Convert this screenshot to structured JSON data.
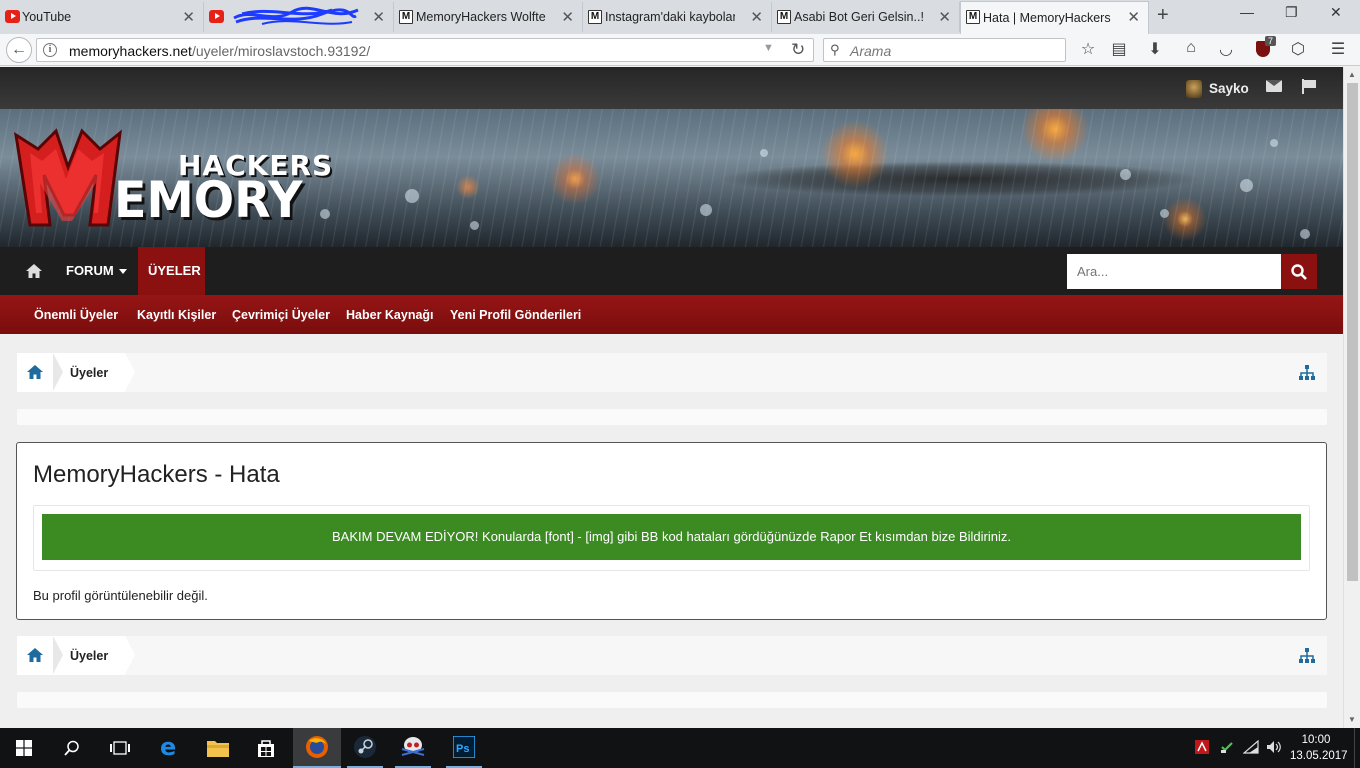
{
  "browser": {
    "tabs": [
      {
        "title": "YouTube",
        "favicon": "youtube-icon"
      },
      {
        "title": "",
        "favicon": "youtube-icon"
      },
      {
        "title": "MemoryHackers Wolfte",
        "favicon": "m-icon"
      },
      {
        "title": "Instagram'daki kaybolan",
        "favicon": "m-icon"
      },
      {
        "title": "Asabi Bot Geri Gelsin..!(S",
        "favicon": "m-icon"
      },
      {
        "title": "Hata | MemoryHackers",
        "favicon": "m-icon"
      }
    ],
    "url_host": "memoryhackers.net",
    "url_path": "/uyeler/miroslavstoch.93192/",
    "search_placeholder": "Arama",
    "ublock_badge": "7"
  },
  "site": {
    "logo_top": "HACKERS",
    "logo_bottom": "EMORY",
    "user_name": "Sayko",
    "nav": {
      "forum": "FORUM",
      "members": "ÜYELER",
      "search_placeholder": "Ara..."
    },
    "subnav": [
      "Önemli Üyeler",
      "Kayıtlı Kişiler",
      "Çevrimiçi Üyeler",
      "Haber Kaynağı",
      "Yeni Profil Gönderileri"
    ],
    "breadcrumb_label": "Üyeler",
    "error_title": "MemoryHackers - Hata",
    "notice": "BAKIM DEVAM EDİYOR! Konularda [font] - [img] gibi BB kod hataları gördüğünüzde Rapor Et kısımdan bize Bildiriniz.",
    "error_message": "Bu profil görüntülenebilir değil."
  },
  "taskbar": {
    "time": "10:00",
    "date": "13.05.2017"
  },
  "colors": {
    "brand_red": "#8b1111",
    "notice_green": "#3b8a22"
  }
}
